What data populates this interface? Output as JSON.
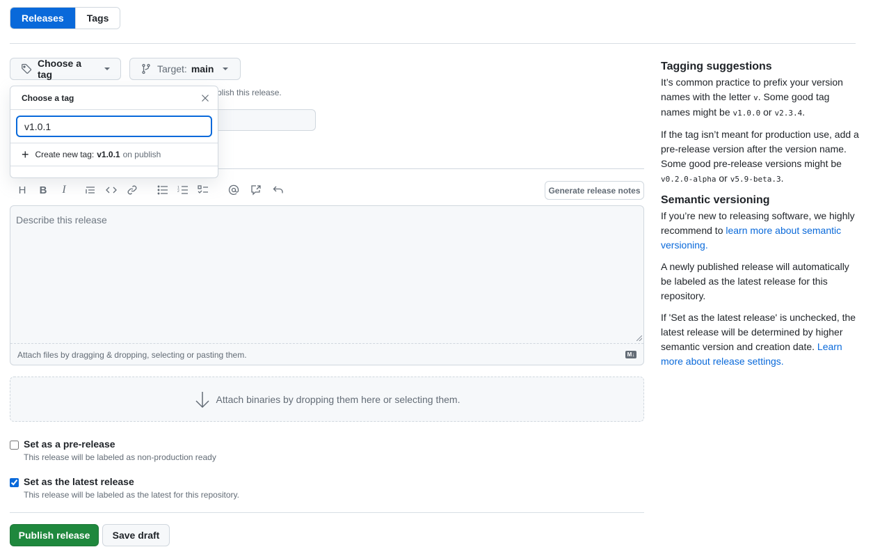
{
  "nav": {
    "tabs": [
      {
        "label": "Releases",
        "active": true
      },
      {
        "label": "Tags",
        "active": false
      }
    ]
  },
  "form": {
    "tag_button_label": "Choose a tag",
    "target_label": "Target:",
    "target_value": "main",
    "hint_visible_text": "blish this release.",
    "title_input_value": ""
  },
  "tag_dropdown": {
    "title": "Choose a tag",
    "filter_value": "v1.0.1",
    "create_prefix": "Create new tag:",
    "create_tag": "v1.0.1",
    "create_suffix": "on publish"
  },
  "toolbar": {
    "icons": [
      "heading-icon",
      "bold-icon",
      "italic-icon",
      "quote-icon",
      "code-icon",
      "link-icon",
      "unordered-list-icon",
      "ordered-list-icon",
      "task-list-icon",
      "mention-icon",
      "reference-icon",
      "undo-icon"
    ],
    "generate_notes_label": "Generate release notes"
  },
  "editor": {
    "placeholder": "Describe this release",
    "value": "",
    "attach_text": "Attach files by dragging & dropping, selecting or pasting them.",
    "markdown_badge": "M↓"
  },
  "binaries": {
    "text": "Attach binaries by dropping them here or selecting them."
  },
  "options": {
    "prerelease": {
      "label": "Set as a pre-release",
      "description": "This release will be labeled as non-production ready",
      "checked": false
    },
    "latest": {
      "label": "Set as the latest release",
      "description": "This release will be labeled as the latest for this repository.",
      "checked": true
    }
  },
  "actions": {
    "publish_label": "Publish release",
    "draft_label": "Save draft"
  },
  "sidebar": {
    "tagging_title": "Tagging suggestions",
    "tagging_p1_a": "It’s common practice to prefix your version names with the letter ",
    "tagging_p1_code1": "v",
    "tagging_p1_b": ". Some good tag names might be ",
    "tagging_p1_code2": "v1.0.0",
    "tagging_p1_c": " or ",
    "tagging_p1_code3": "v2.3.4",
    "tagging_p1_d": ".",
    "tagging_p2_a": "If the tag isn’t meant for production use, add a pre-release version after the version name. Some good pre-release versions might be ",
    "tagging_p2_code1": "v0.2.0-alpha",
    "tagging_p2_b": " or ",
    "tagging_p2_code2": "v5.9-beta.3",
    "tagging_p2_c": ".",
    "semver_title": "Semantic versioning",
    "semver_p1_a": "If you’re new to releasing software, we highly recommend to ",
    "semver_p1_link": "learn more about semantic versioning.",
    "semver_p2": "A newly published release will automatically be labeled as the latest release for this repository.",
    "semver_p3_a": "If 'Set as the latest release' is unchecked, the latest release will be determined by higher semantic version and creation date. ",
    "semver_p3_link": "Learn more about release settings."
  }
}
